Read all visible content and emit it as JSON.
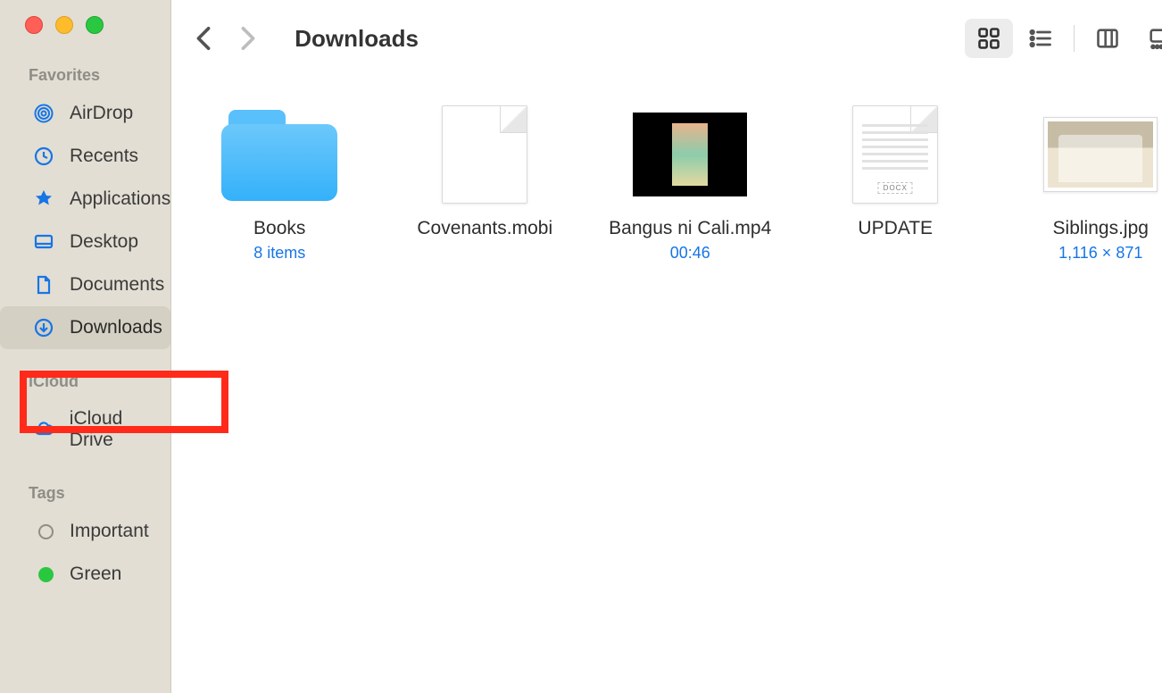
{
  "window": {
    "title": "Downloads"
  },
  "sidebar": {
    "sections": [
      {
        "label": "Favorites",
        "items": [
          {
            "label": "AirDrop",
            "icon": "airdrop-icon"
          },
          {
            "label": "Recents",
            "icon": "clock-icon"
          },
          {
            "label": "Applications",
            "icon": "app-icon"
          },
          {
            "label": "Desktop",
            "icon": "desktop-icon"
          },
          {
            "label": "Documents",
            "icon": "document-icon"
          },
          {
            "label": "Downloads",
            "icon": "download-icon",
            "active": true
          }
        ]
      },
      {
        "label": "iCloud",
        "items": [
          {
            "label": "iCloud Drive",
            "icon": "cloud-icon"
          }
        ]
      },
      {
        "label": "Tags",
        "items": [
          {
            "label": "Important",
            "tag_color": "outline"
          },
          {
            "label": "Green",
            "tag_color": "green"
          }
        ]
      }
    ]
  },
  "files": [
    {
      "name": "Books",
      "kind": "folder",
      "sub": "8 items"
    },
    {
      "name": "Covenants.mobi",
      "kind": "doc"
    },
    {
      "name": "Bangus ni Cali.mp4",
      "kind": "video",
      "sub": "00:46"
    },
    {
      "name": "UPDATE",
      "kind": "docx",
      "badge": "DOCX"
    },
    {
      "name": "Siblings.jpg",
      "kind": "image",
      "sub": "1,116 × 871"
    }
  ]
}
